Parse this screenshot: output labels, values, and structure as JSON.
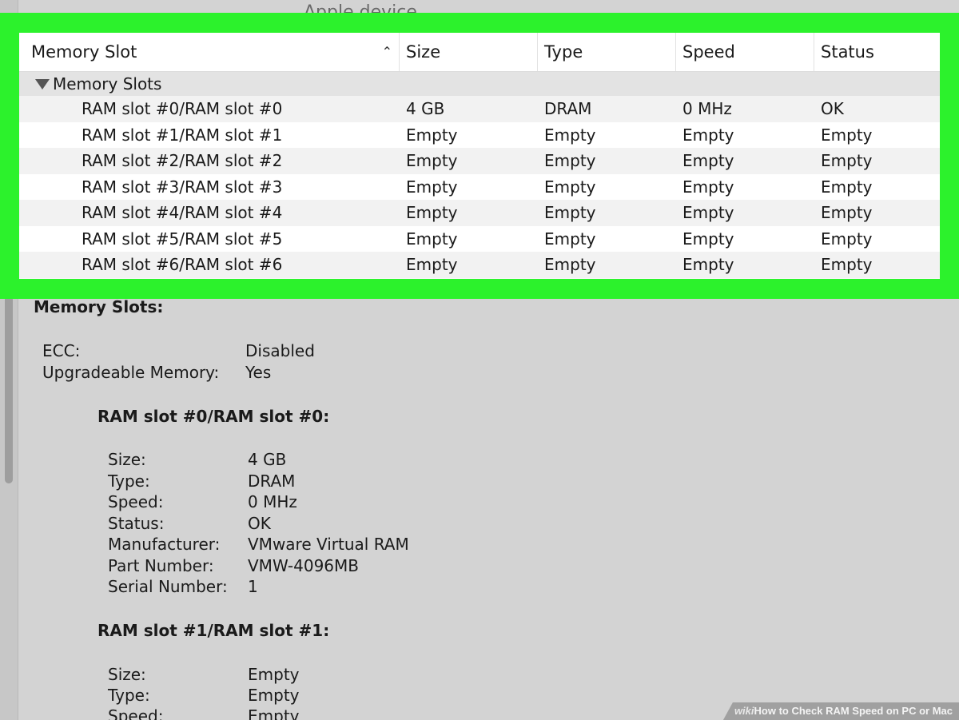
{
  "top_ghost_text": "Apple device",
  "table": {
    "columns": {
      "slot": "Memory Slot",
      "size": "Size",
      "type": "Type",
      "speed": "Speed",
      "status": "Status"
    },
    "group_label": "Memory Slots",
    "rows": [
      {
        "slot": "RAM slot #0/RAM slot #0",
        "size": "4 GB",
        "type": "DRAM",
        "speed": "0 MHz",
        "status": "OK"
      },
      {
        "slot": "RAM slot #1/RAM slot #1",
        "size": "Empty",
        "type": "Empty",
        "speed": "Empty",
        "status": "Empty"
      },
      {
        "slot": "RAM slot #2/RAM slot #2",
        "size": "Empty",
        "type": "Empty",
        "speed": "Empty",
        "status": "Empty"
      },
      {
        "slot": "RAM slot #3/RAM slot #3",
        "size": "Empty",
        "type": "Empty",
        "speed": "Empty",
        "status": "Empty"
      },
      {
        "slot": "RAM slot #4/RAM slot #4",
        "size": "Empty",
        "type": "Empty",
        "speed": "Empty",
        "status": "Empty"
      },
      {
        "slot": "RAM slot #5/RAM slot #5",
        "size": "Empty",
        "type": "Empty",
        "speed": "Empty",
        "status": "Empty"
      },
      {
        "slot": "RAM slot #6/RAM slot #6",
        "size": "Empty",
        "type": "Empty",
        "speed": "Empty",
        "status": "Empty"
      }
    ]
  },
  "details": {
    "title": "Memory Slots:",
    "ecc_label": "ECC:",
    "ecc_value": "Disabled",
    "upgradeable_label": "Upgradeable Memory:",
    "upgradeable_value": "Yes",
    "slot0": {
      "heading": "RAM slot #0/RAM slot #0:",
      "size_label": "Size:",
      "size_value": "4 GB",
      "type_label": "Type:",
      "type_value": "DRAM",
      "speed_label": "Speed:",
      "speed_value": "0 MHz",
      "status_label": "Status:",
      "status_value": "OK",
      "manufacturer_label": "Manufacturer:",
      "manufacturer_value": "VMware Virtual RAM",
      "part_label": "Part Number:",
      "part_value": "VMW-4096MB",
      "serial_label": "Serial Number:",
      "serial_value": "1"
    },
    "slot1": {
      "heading": "RAM slot #1/RAM slot #1:",
      "size_label": "Size:",
      "size_value": "Empty",
      "type_label": "Type:",
      "type_value": "Empty",
      "speed_label": "Speed:",
      "speed_value": "Empty"
    }
  },
  "watermark": {
    "brand": "wiki",
    "title": "How to Check RAM Speed on PC or Mac"
  },
  "colors": {
    "highlight": "#2cf22c",
    "background": "#d3d3d3"
  }
}
